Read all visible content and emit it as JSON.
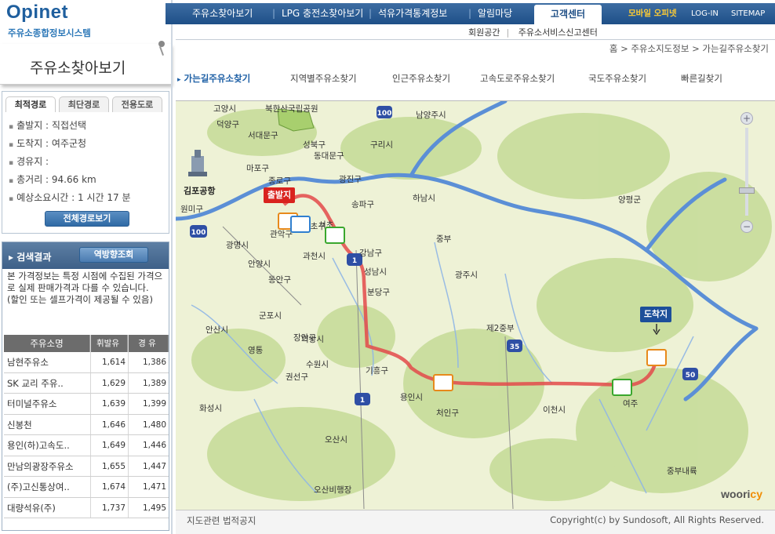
{
  "brand": {
    "name": "Opinet",
    "subtitle": "주유소종합정보시스템",
    "section_title": "주유소찾아보기"
  },
  "nav": {
    "items": [
      "주유소찾아보기",
      "LPG 충전소찾아보기",
      "석유가격통계정보",
      "알림마당"
    ],
    "active": "고객센터",
    "mobile": "모바일 오피넷",
    "login": "LOG-IN",
    "sitemap": "SITEMAP",
    "sub": [
      "회원공간",
      "주유소서비스신고센터"
    ]
  },
  "breadcrumb": "홈 > 주유소지도정보 > 가는길주유소찾기",
  "subtabs": [
    "가는길주유소찾기",
    "지역별주유소찾기",
    "인근주유소찾기",
    "고속도로주유소찾기",
    "국도주유소찾기",
    "빠른길찾기"
  ],
  "route": {
    "tabs": [
      "최적경로",
      "최단경로",
      "전용도로"
    ],
    "start": "출발지 : 직접선택",
    "end": "도착지 : 여주군청",
    "via": "경유지 :",
    "distance": "총거리 : 94.66 km",
    "time": "예상소요시간 : 1 시간  17 분",
    "full_route_button": "전체경로보기"
  },
  "results": {
    "title": "검색결과",
    "reverse_button": "역방향조회",
    "notice": "본 가격정보는 특정 시점에 수집된 가격으로 실제 판매가격과 다를 수 있습니다.\n(할인 또는 셀프가격이 제공될 수 있음)",
    "headers": [
      "주유소명",
      "휘발유",
      "경 유"
    ],
    "rows": [
      {
        "name": "남현주유소",
        "gas": "1,614",
        "diesel": "1,386"
      },
      {
        "name": "SK 교리 주유..",
        "gas": "1,629",
        "diesel": "1,389"
      },
      {
        "name": "터미널주유소",
        "gas": "1,639",
        "diesel": "1,399"
      },
      {
        "name": "신봉천",
        "gas": "1,646",
        "diesel": "1,480"
      },
      {
        "name": "용인(하)고속도..",
        "gas": "1,649",
        "diesel": "1,446"
      },
      {
        "name": "만남의광장주유소",
        "gas": "1,655",
        "diesel": "1,447"
      },
      {
        "name": "(주)고신통상여..",
        "gas": "1,674",
        "diesel": "1,471"
      },
      {
        "name": "대량석유(주)",
        "gas": "1,737",
        "diesel": "1,495"
      }
    ]
  },
  "map": {
    "start_badge": "출발지",
    "end_badge": "도착지",
    "airport": "김포공항",
    "watermark_a": "woori",
    "watermark_b": "cy",
    "labels": [
      "고양시",
      "덕양구",
      "서대문구",
      "마포구",
      "종로구",
      "성북구",
      "동대문구",
      "구리시",
      "남양주시",
      "광진구",
      "하남시",
      "송파구",
      "원미구",
      "광명시",
      "관악구",
      "서초구",
      "강남구",
      "과천시",
      "안양시",
      "동안구",
      "성남시",
      "분당구",
      "광주시",
      "중부",
      "안산시",
      "군포시",
      "의왕시",
      "장안구",
      "수원시",
      "권선구",
      "영통",
      "기흥구",
      "용인시",
      "처인구",
      "제2중부",
      "이천시",
      "화성시",
      "오산시",
      "오산비행장",
      "양평군",
      "여주",
      "중부내륙",
      "북한산국립공원",
      "서초"
    ],
    "route_colors": {
      "route": "#e34a4a",
      "river": "#5b8fd6",
      "green": "#b9d38b"
    }
  },
  "footer": {
    "legal": "지도관련 법적공지",
    "copyright": "Copyright(c) by Sundosoft, All Rights Reserved."
  }
}
